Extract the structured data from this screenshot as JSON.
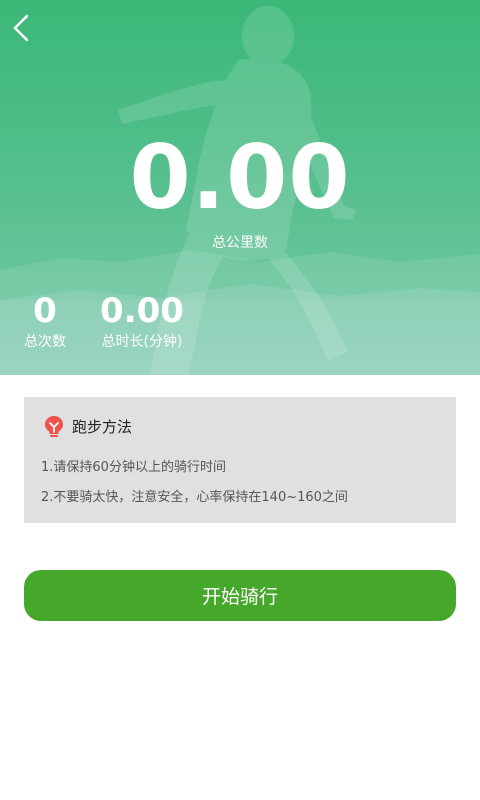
{
  "header": {
    "back_icon": "chevron-left-icon"
  },
  "summary": {
    "total_km": "0.00",
    "total_km_label": "总公里数",
    "total_count": "0",
    "total_count_label": "总次数",
    "total_duration": "0.00",
    "total_duration_label": "总时长(分钟)"
  },
  "tips": {
    "icon": "lightbulb-icon",
    "title": "跑步方法",
    "items": [
      "1.请保持60分钟以上的骑行时间",
      "2.不要骑太快，注意安全，心率保持在140~160之间"
    ]
  },
  "action": {
    "start_label": "开始骑行"
  },
  "colors": {
    "hero_green": "#3bb878",
    "button_green": "#45a82b",
    "tips_bg": "#e0e0e0",
    "icon_red": "#f0524a"
  }
}
